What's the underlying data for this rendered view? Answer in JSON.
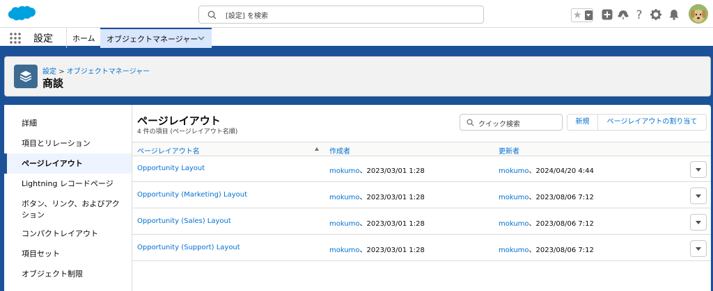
{
  "header": {
    "search_placeholder": "[設定] を検索",
    "icons": [
      "salesforce-cloud-logo",
      "star-icon",
      "plus-icon",
      "trailhead-icon",
      "help-icon",
      "gear-icon",
      "bell-icon",
      "avatar"
    ]
  },
  "context_bar": {
    "app_name": "設定",
    "home_tab": "ホーム",
    "active_tab": "オブジェクトマネージャー"
  },
  "page_header": {
    "breadcrumb_setup": "設定",
    "breadcrumb_sep": ">",
    "breadcrumb_object_manager": "オブジェクトマネージャー",
    "title": "商談"
  },
  "sidebar": {
    "items": [
      {
        "label": "詳細"
      },
      {
        "label": "項目とリレーション"
      },
      {
        "label": "ページレイアウト",
        "active": true
      },
      {
        "label": "Lightning レコードページ"
      },
      {
        "label": "ボタン、リンク、およびアクション"
      },
      {
        "label": "コンパクトレイアウト"
      },
      {
        "label": "項目セット"
      },
      {
        "label": "オブジェクト制限"
      }
    ]
  },
  "main": {
    "title": "ページレイアウト",
    "subtitle": "4 件の項目 (ページレイアウト名順)",
    "quick_search_placeholder": "クイック検索",
    "new_button": "新規",
    "assign_button": "ページレイアウトの割り当て",
    "columns": [
      "ページレイアウト名",
      "作成者",
      "更新者"
    ],
    "rows": [
      {
        "name": "Opportunity Layout",
        "created_user": "mokumo",
        "created_date": "、2023/03/01 1:28",
        "modified_user": "mokumo",
        "modified_date": "、2024/04/20 4:44"
      },
      {
        "name": "Opportunity (Marketing) Layout",
        "created_user": "mokumo",
        "created_date": "、2023/03/01 1:28",
        "modified_user": "mokumo",
        "modified_date": "、2023/08/06 7:12"
      },
      {
        "name": "Opportunity (Sales) Layout",
        "created_user": "mokumo",
        "created_date": "、2023/03/01 1:28",
        "modified_user": "mokumo",
        "modified_date": "、2023/08/06 7:12"
      },
      {
        "name": "Opportunity (Support) Layout",
        "created_user": "mokumo",
        "created_date": "、2023/03/01 1:28",
        "modified_user": "mokumo",
        "modified_date": "、2023/08/06 7:12"
      }
    ]
  },
  "colors": {
    "brand_blue": "#1b5297",
    "link_blue": "#0070d2",
    "salesforce_cloud": "#00a1e0",
    "object_icon": "#3c6b92"
  }
}
